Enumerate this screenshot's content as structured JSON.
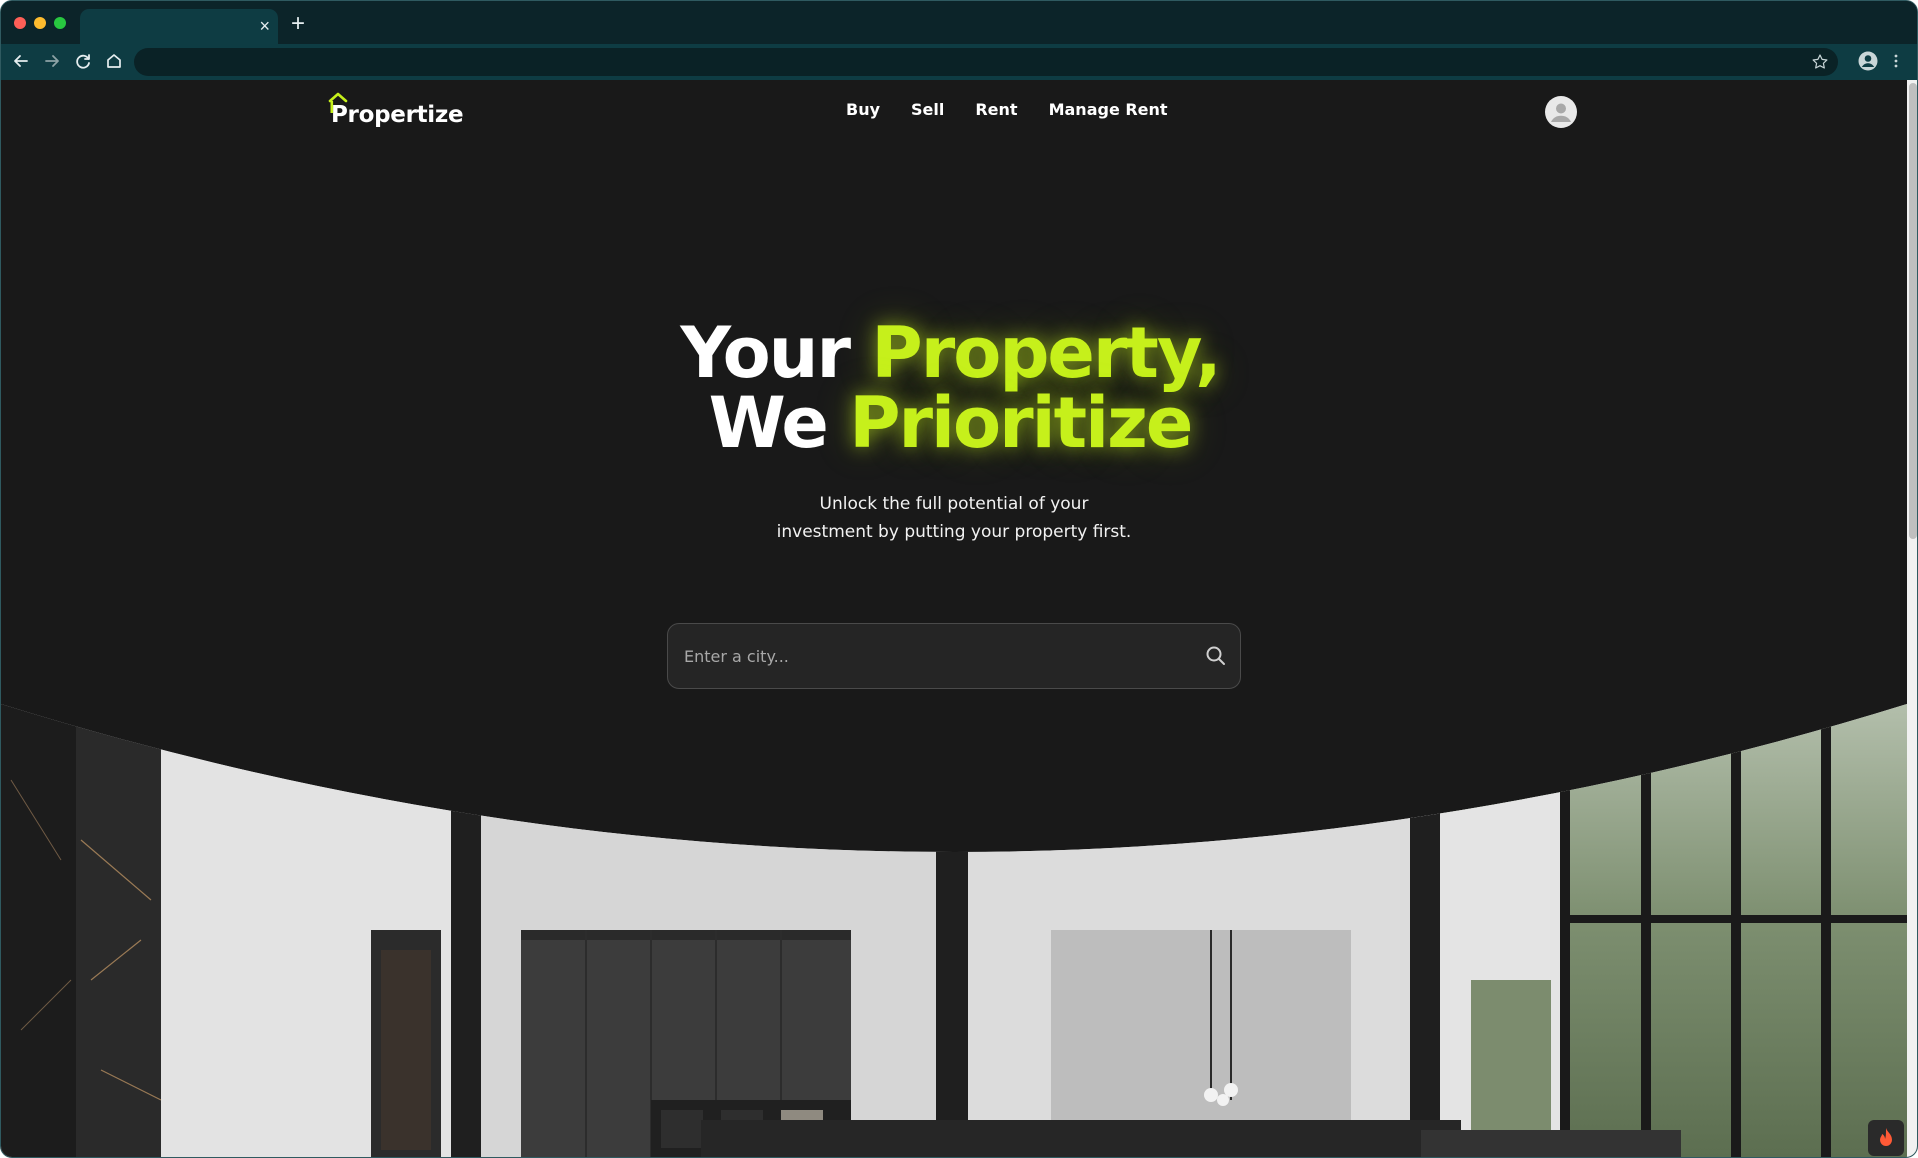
{
  "browser": {
    "tab_close": "×",
    "new_tab": "+"
  },
  "site": {
    "logo_text": "Propertize"
  },
  "nav": {
    "items": [
      "Buy",
      "Sell",
      "Rent",
      "Manage Rent"
    ]
  },
  "hero": {
    "line1_white": "Your ",
    "line1_accent": "Property,",
    "line2_white": "We ",
    "line2_accent": "Prioritize",
    "subtitle_line1": "Unlock the full potential of your",
    "subtitle_line2": "investment by putting your property first."
  },
  "search": {
    "placeholder": "Enter a city..."
  },
  "colors": {
    "accent": "#c6f01b",
    "background": "#191919",
    "chrome": "#0c2429"
  },
  "icons": [
    "back-arrow-icon",
    "forward-arrow-icon",
    "reload-icon",
    "home-icon",
    "star-icon",
    "profile-icon",
    "more-icon",
    "search-icon",
    "flame-icon",
    "house-logo-icon",
    "avatar-icon"
  ]
}
